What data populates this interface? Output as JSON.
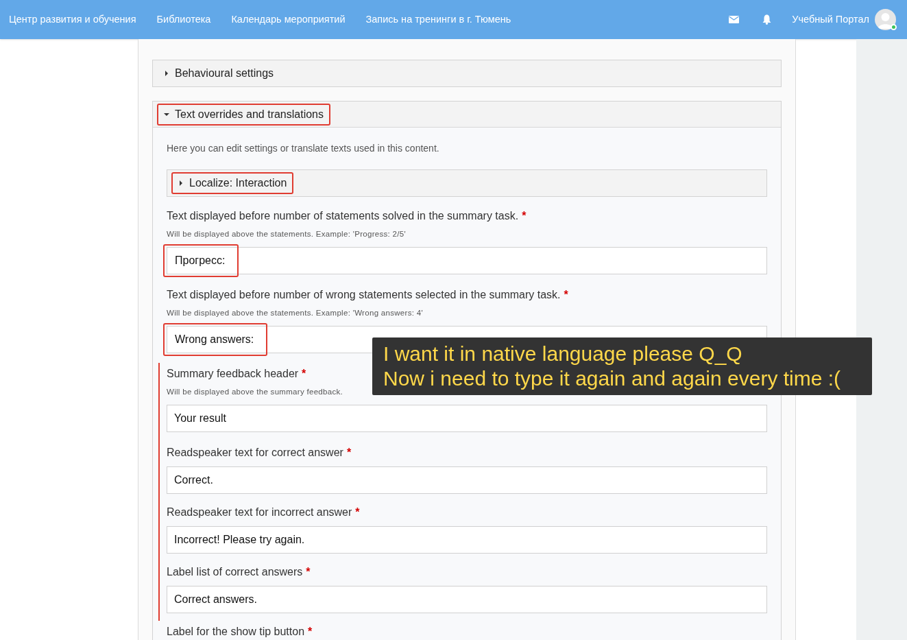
{
  "navbar": {
    "links": [
      "Центр развития и обучения",
      "Библиотека",
      "Календарь мероприятий",
      "Запись на тренинги в г. Тюмень"
    ],
    "user_name": "Учебный Портал",
    "online": true
  },
  "sections": [
    {
      "title": "Behavioural settings",
      "expanded": false,
      "highlighted": false
    },
    {
      "title": "Text overrides and translations",
      "expanded": true,
      "highlighted": true,
      "description": "Here you can edit settings or translate texts used in this content.",
      "subsection": {
        "title": "Localize: Interaction",
        "expanded": false,
        "highlighted": true
      },
      "fields": [
        {
          "label": "Text displayed before number of statements solved in the summary task.",
          "required_mark": "*",
          "help": "Will be displayed above the statements. Example: 'Progress: 2/5'",
          "value": "Прогресс:",
          "highlighted": true
        },
        {
          "label": "Text displayed before number of wrong statements selected in the summary task.",
          "required_mark": "*",
          "help": "Will be displayed above the statements. Example: 'Wrong answers: 4'",
          "value": "Wrong answers:",
          "highlighted": true
        },
        {
          "label": "Summary feedback header",
          "required_mark": "*",
          "help": "Will be displayed above the summary feedback.",
          "value": "Your result",
          "bracketed": true
        },
        {
          "label": "Readspeaker text for correct answer",
          "required_mark": "*",
          "value": "Correct.",
          "bracketed": true
        },
        {
          "label": "Readspeaker text for incorrect answer",
          "required_mark": "*",
          "value": "Incorrect! Please try again.",
          "bracketed": true
        },
        {
          "label": "Label list of correct answers",
          "required_mark": "*",
          "value": "Correct answers.",
          "bracketed": true
        },
        {
          "label": "Label for the show tip button",
          "required_mark": "*"
        }
      ]
    }
  ],
  "caption": [
    "I want it in native language please Q_Q",
    "Now i need to type it again and again every time :("
  ]
}
